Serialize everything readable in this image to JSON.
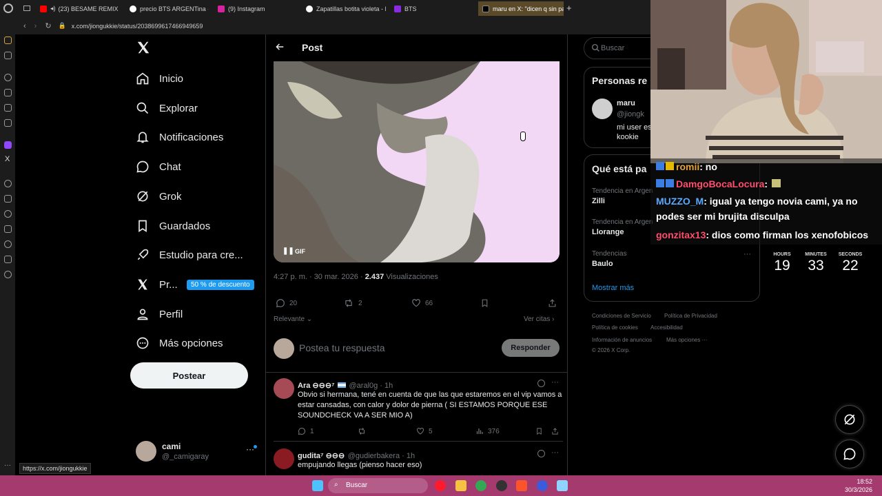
{
  "browser": {
    "tabs": [
      {
        "label": "(23) BESAME REMIX -"
      },
      {
        "label": "precio BTS ARGENTina - ("
      },
      {
        "label": "(9) Instagram"
      },
      {
        "label": "Zapatillas botita violeta - E"
      },
      {
        "label": "BTS"
      },
      {
        "label": "maru en X: \"dicen q sin pa"
      }
    ],
    "url": "x.com/jiongukkie/status/2038699617466949659",
    "status_url": "https://x.com/jiongukkie"
  },
  "nav": {
    "items": [
      {
        "label": "Inicio"
      },
      {
        "label": "Explorar"
      },
      {
        "label": "Notificaciones"
      },
      {
        "label": "Chat"
      },
      {
        "label": "Grok"
      },
      {
        "label": "Guardados"
      },
      {
        "label": "Estudio para cre..."
      },
      {
        "label": "Pr..."
      },
      {
        "label": "Perfil"
      },
      {
        "label": "Más opciones"
      }
    ],
    "premium_badge": "50 % de descuento",
    "post_button": "Postear",
    "account": {
      "name": "cami",
      "handle": "@_camigaray"
    }
  },
  "post": {
    "header_title": "Post",
    "gif_label": "GIF",
    "time": "4:27 p. m. · 30 mar. 2026 ·",
    "views": "2.437",
    "views_label": "Visualizaciones",
    "replies": "20",
    "reposts": "2",
    "likes": "66",
    "sort_label": "Relevante",
    "quotes_label": "Ver citas",
    "reply_placeholder": "Postea tu respuesta",
    "reply_button": "Responder"
  },
  "replies": [
    {
      "name": "Ara ⊖⊖⊖⁷",
      "handle": "@aral0g · 1h",
      "text": "Obvio si hermana, tené en cuenta de que las que estaremos en el vip vamos a estar cansadas, con calor y dolor de pierna ( SI ESTAMOS PORQUE ESE SOUNDCHECK VA A SER MIO A)",
      "replies": "1",
      "likes": "5",
      "views": "376"
    },
    {
      "name": "gudita⁷ ⊖⊖⊖",
      "handle": "@gudierbakera · 1h",
      "text": "empujando llegas (pienso hacer eso)"
    }
  ],
  "right": {
    "search_placeholder": "Buscar",
    "people_title": "Personas re",
    "person": {
      "name": "maru",
      "handle": "@jiongk",
      "bio": "mi user es\nkookie"
    },
    "trends_title": "Qué está pa",
    "trends": [
      {
        "context": "Tendencia en Argen",
        "name": "Zilli"
      },
      {
        "context": "Tendencia en Argen",
        "name": "Llorange"
      },
      {
        "context": "Tendencias",
        "name": "Baulo"
      }
    ],
    "show_more": "Mostrar más",
    "footer": {
      "terms": "Condiciones de Servicio",
      "privacy": "Política de Privacidad",
      "cookies": "Política de cookies",
      "accessibility": "Accesibilidad",
      "ads": "Información de anuncios",
      "more": "Más opciones ···",
      "copyright": "© 2026 X Corp."
    }
  },
  "chat": [
    {
      "user": "romii",
      "text": ": no",
      "color": "#e6a23c"
    },
    {
      "user": "DamgoBocaLocura",
      "text": ":",
      "color": "#ff4d6d"
    },
    {
      "user": "MUZZO_M",
      "text": ": igual ya tengo novia cami, ya no podes ser mi brujita disculpa",
      "color": "#5aa9ff"
    },
    {
      "user": "gonzitax13",
      "text": ": dios como firman los xenofobicos",
      "color": "#ff4d6d"
    }
  ],
  "timer": {
    "hours_label": "HOURS",
    "hours": "19",
    "minutes_label": "MINUTES",
    "minutes": "33",
    "seconds_label": "SECONDS",
    "seconds": "22"
  },
  "taskbar": {
    "search": "Buscar",
    "time": "18:52",
    "date": "30/3/2026"
  },
  "colors": {
    "accent": "#1d9bf0",
    "taskbar": "#a53a6f",
    "background": "#000000"
  }
}
